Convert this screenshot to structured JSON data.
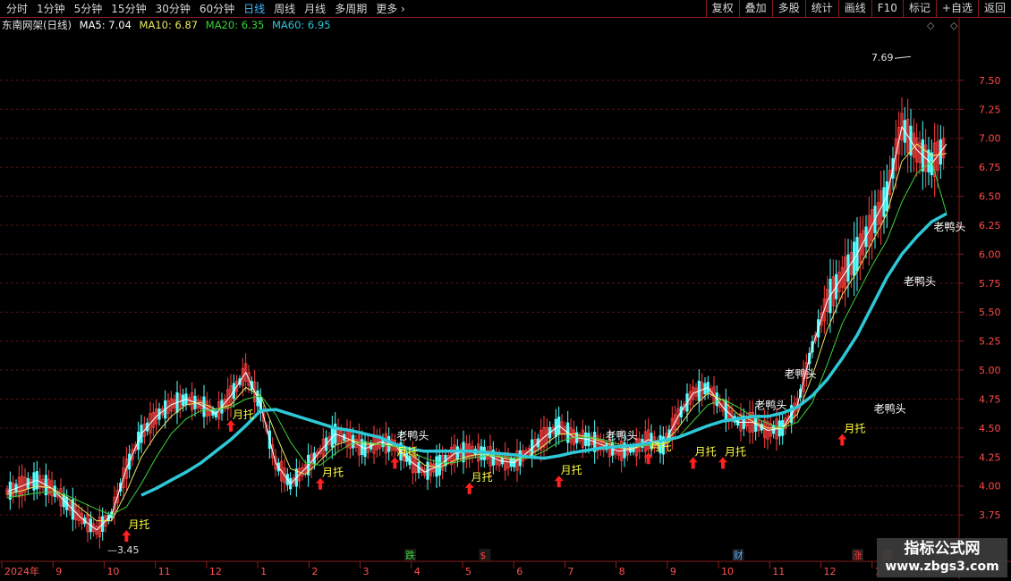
{
  "toolbar": {
    "periods": [
      "分时",
      "1分钟",
      "5分钟",
      "15分钟",
      "30分钟",
      "60分钟",
      "日线",
      "周线",
      "月线",
      "多周期",
      "更多"
    ],
    "active_period": "日线",
    "actions": [
      "复权",
      "叠加",
      "多股",
      "统计",
      "画线",
      "F10",
      "标记",
      "+自选",
      "返回"
    ]
  },
  "info": {
    "title": "东南网架(日线)",
    "ma5": "MA5: 7.04",
    "ma10": "MA10: 6.87",
    "ma20": "MA20: 6.35",
    "ma60": "MA60: 6.95"
  },
  "corner_icons": "◇ ◇",
  "colors": {
    "up": "#ff4040",
    "down": "#54ffff",
    "ma5": "#ffffff",
    "ma10": "#e8e864",
    "ma20": "#3ad23a",
    "ma60": "#2ec8d8",
    "signal_text": "#ffff40",
    "arrow": "#ff2020"
  },
  "chart_data": {
    "type": "line",
    "description_note": "",
    "xlabel": "",
    "ylabel": "",
    "ylim": [
      3.35,
      7.9
    ],
    "y_ticks": [
      3.75,
      4.0,
      4.25,
      4.5,
      4.75,
      5.0,
      5.25,
      5.5,
      5.75,
      6.0,
      6.25,
      6.5,
      6.75,
      7.0,
      7.25,
      7.5
    ],
    "x_ticks": [
      "2024年",
      "9",
      "10",
      "11",
      "12",
      "1",
      "2",
      "3",
      "4",
      "5",
      "6",
      "7",
      "8",
      "9",
      "10",
      "11",
      "12",
      "1",
      "2"
    ],
    "series": [
      {
        "name": "MA5",
        "values": [
          3.95,
          4.0,
          4.05,
          3.98,
          3.85,
          3.72,
          3.62,
          3.75,
          4.15,
          4.45,
          4.6,
          4.7,
          4.75,
          4.7,
          4.62,
          4.78,
          4.98,
          4.7,
          4.2,
          4.02,
          4.15,
          4.3,
          4.45,
          4.4,
          4.32,
          4.38,
          4.35,
          4.22,
          4.12,
          4.18,
          4.28,
          4.3,
          4.28,
          4.22,
          4.2,
          4.3,
          4.42,
          4.52,
          4.42,
          4.4,
          4.35,
          4.3,
          4.32,
          4.4,
          4.35,
          4.6,
          4.8,
          4.85,
          4.68,
          4.55,
          4.55,
          4.48,
          4.5,
          4.7,
          5.2,
          5.6,
          5.8,
          6.0,
          6.25,
          6.5,
          7.1,
          6.9,
          6.78,
          6.95
        ]
      },
      {
        "name": "MA10",
        "values": [
          3.93,
          3.96,
          4.0,
          3.98,
          3.9,
          3.8,
          3.7,
          3.7,
          3.95,
          4.25,
          4.45,
          4.6,
          4.7,
          4.72,
          4.66,
          4.7,
          4.85,
          4.78,
          4.45,
          4.15,
          4.1,
          4.22,
          4.35,
          4.4,
          4.36,
          4.36,
          4.35,
          4.28,
          4.18,
          4.16,
          4.22,
          4.26,
          4.28,
          4.25,
          4.22,
          4.26,
          4.35,
          4.45,
          4.45,
          4.42,
          4.38,
          4.33,
          4.32,
          4.37,
          4.36,
          4.5,
          4.68,
          4.8,
          4.74,
          4.62,
          4.56,
          4.5,
          4.5,
          4.62,
          4.95,
          5.35,
          5.65,
          5.85,
          6.1,
          6.35,
          6.8,
          6.95,
          6.85,
          6.87
        ]
      },
      {
        "name": "MA20",
        "values": [
          3.9,
          3.92,
          3.94,
          3.95,
          3.92,
          3.86,
          3.8,
          3.75,
          3.82,
          4.02,
          4.25,
          4.45,
          4.58,
          4.65,
          4.66,
          4.68,
          4.75,
          4.78,
          4.62,
          4.38,
          4.2,
          4.18,
          4.28,
          4.36,
          4.38,
          4.36,
          4.34,
          4.3,
          4.24,
          4.2,
          4.2,
          4.24,
          4.26,
          4.26,
          4.24,
          4.24,
          4.3,
          4.38,
          4.42,
          4.42,
          4.4,
          4.36,
          4.34,
          4.35,
          4.36,
          4.42,
          4.56,
          4.7,
          4.75,
          4.68,
          4.6,
          4.54,
          4.5,
          4.55,
          4.72,
          5.05,
          5.4,
          5.65,
          5.9,
          6.12,
          6.45,
          6.7,
          6.8,
          6.35
        ]
      },
      {
        "name": "MA60",
        "values": [
          null,
          null,
          null,
          null,
          null,
          null,
          null,
          null,
          null,
          3.92,
          3.98,
          4.05,
          4.12,
          4.2,
          4.3,
          4.4,
          4.52,
          4.65,
          4.66,
          4.62,
          4.58,
          4.54,
          4.5,
          4.48,
          4.45,
          4.42,
          4.36,
          4.32,
          4.3,
          4.3,
          4.3,
          4.3,
          4.29,
          4.28,
          4.27,
          4.25,
          4.24,
          4.26,
          4.29,
          4.31,
          4.33,
          4.34,
          4.35,
          4.37,
          4.39,
          4.42,
          4.47,
          4.52,
          4.56,
          4.58,
          4.6,
          4.6,
          4.63,
          4.68,
          4.78,
          4.92,
          5.1,
          5.3,
          5.55,
          5.8,
          6.0,
          6.15,
          6.28,
          6.35
        ]
      }
    ],
    "high_marker": {
      "label": "7.69",
      "value": 7.69
    },
    "low_marker": {
      "label": "3.45",
      "value": 3.45
    },
    "signal_labels": [
      {
        "text": "月托",
        "index": 8,
        "price": 3.65,
        "arrow": true
      },
      {
        "text": "月托",
        "index": 15,
        "price": 4.6,
        "arrow": true
      },
      {
        "text": "月托",
        "index": 21,
        "price": 4.1,
        "arrow": true
      },
      {
        "text": "老鸭头",
        "index": 26,
        "price": 4.42,
        "arrow": false
      },
      {
        "text": "月托",
        "index": 26,
        "price": 4.28,
        "arrow": true
      },
      {
        "text": "月托",
        "index": 31,
        "price": 4.06,
        "arrow": true
      },
      {
        "text": "月托",
        "index": 37,
        "price": 4.12,
        "arrow": true
      },
      {
        "text": "老鸭头",
        "index": 40,
        "price": 4.42,
        "arrow": false
      },
      {
        "text": "月托",
        "index": 43,
        "price": 4.32,
        "arrow": true
      },
      {
        "text": "月托",
        "index": 46,
        "price": 4.28,
        "arrow": true
      },
      {
        "text": "月托",
        "index": 48,
        "price": 4.28,
        "arrow": true
      },
      {
        "text": "老鸭头",
        "index": 50,
        "price": 4.68,
        "arrow": false
      },
      {
        "text": "老鸭头",
        "index": 52,
        "price": 4.95,
        "arrow": false
      },
      {
        "text": "月托",
        "index": 56,
        "price": 4.48,
        "arrow": true
      },
      {
        "text": "老鸭头",
        "index": 58,
        "price": 4.65,
        "arrow": false
      },
      {
        "text": "老鸭头",
        "index": 60,
        "price": 5.75,
        "arrow": false
      },
      {
        "text": "老鸭头",
        "index": 62,
        "price": 6.22,
        "arrow": false
      }
    ],
    "event_markers": [
      {
        "text": "跌",
        "color": "#3ad23a",
        "index": 27
      },
      {
        "text": "$",
        "color": "#ff4040",
        "index": 32
      },
      {
        "text": "财",
        "color": "#54b0ff",
        "index": 49
      },
      {
        "text": "涨",
        "color": "#ff4040",
        "index": 57
      },
      {
        "text": "预",
        "color": "#ff8040",
        "index": 59
      }
    ]
  },
  "watermark": {
    "title": "指标公式网",
    "url": "www.zbgs3.com"
  }
}
